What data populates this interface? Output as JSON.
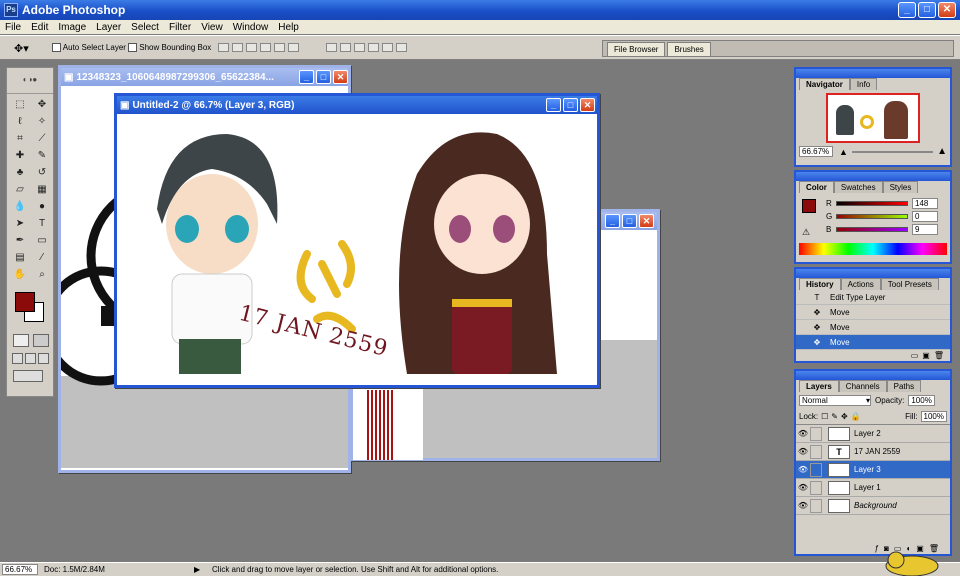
{
  "app": {
    "title": "Adobe Photoshop",
    "logo": "Ps"
  },
  "window_controls": {
    "min": "_",
    "max": "□",
    "close": "✕"
  },
  "menu": [
    "File",
    "Edit",
    "Image",
    "Layer",
    "Select",
    "Filter",
    "View",
    "Window",
    "Help"
  ],
  "options": {
    "auto_select": "Auto Select Layer",
    "show_bounding": "Show Bounding Box",
    "well_tabs": [
      "File Browser",
      "Brushes"
    ]
  },
  "colors": {
    "foreground": "#8b0a0a",
    "background": "#ffffff",
    "accent": "#2456d6",
    "selection": "#3169c6"
  },
  "documents": {
    "back": {
      "title": "12348323_1060648987299306_65622384..."
    },
    "front": {
      "title": "Untitled-2 @ 66.7% (Layer 3, RGB)",
      "caption": "17 JAN 2559"
    }
  },
  "navigator": {
    "tabs": [
      "Navigator",
      "Info"
    ],
    "zoom": "66.67%"
  },
  "color_palette": {
    "tabs": [
      "Color",
      "Swatches",
      "Styles"
    ],
    "channels": [
      {
        "label": "R",
        "value": "148"
      },
      {
        "label": "G",
        "value": "0"
      },
      {
        "label": "B",
        "value": "9"
      }
    ]
  },
  "history": {
    "tabs": [
      "History",
      "Actions",
      "Tool Presets"
    ],
    "items": [
      {
        "icon": "T",
        "label": "Edit Type Layer",
        "selected": false
      },
      {
        "icon": "✥",
        "label": "Move",
        "selected": false
      },
      {
        "icon": "✥",
        "label": "Move",
        "selected": false
      },
      {
        "icon": "✥",
        "label": "Move",
        "selected": true
      }
    ]
  },
  "layers": {
    "tabs": [
      "Layers",
      "Channels",
      "Paths"
    ],
    "blend_mode": "Normal",
    "opacity_label": "Opacity:",
    "opacity": "100%",
    "lock_label": "Lock:",
    "fill_label": "Fill:",
    "fill": "100%",
    "items": [
      {
        "name": "Layer 2",
        "thumb": "",
        "selected": false
      },
      {
        "name": "17 JAN 2559",
        "thumb": "T",
        "selected": false
      },
      {
        "name": "Layer 3",
        "thumb": "",
        "selected": true
      },
      {
        "name": "Layer 1",
        "thumb": "",
        "selected": false
      },
      {
        "name": "Background",
        "thumb": "",
        "selected": false
      }
    ]
  },
  "status": {
    "zoom": "66.67%",
    "doc": "Doc: 1.5M/2.84M",
    "hint": "Click and drag to move layer or selection.  Use Shift and Alt for additional options."
  }
}
